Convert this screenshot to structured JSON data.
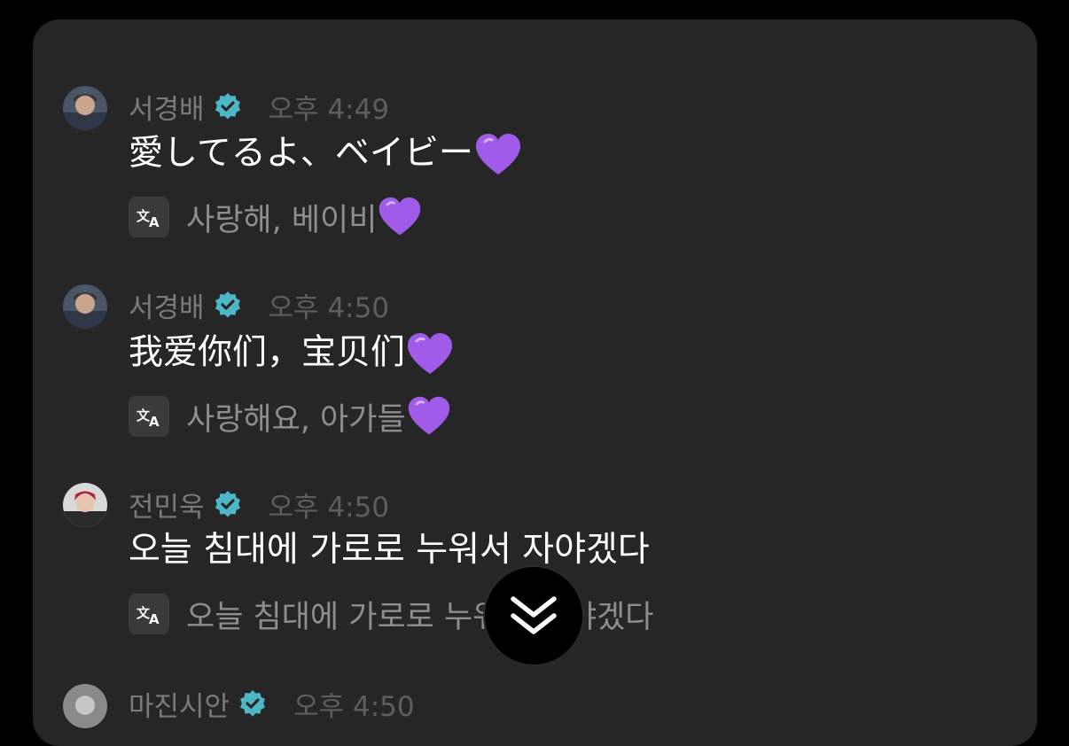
{
  "messages": [
    {
      "username": "서경배",
      "time": "오후 4:49",
      "text": "愛してるよ、ベイビー",
      "text_emoji": "purple-heart",
      "translation": "사랑해, 베이비",
      "translation_emoji": "purple-heart"
    },
    {
      "username": "서경배",
      "time": "오후 4:50",
      "text": "我爱你们，宝贝们",
      "text_emoji": "purple-heart",
      "translation": "사랑해요, 아가들",
      "translation_emoji": "purple-heart"
    },
    {
      "username": "전민욱",
      "time": "오후 4:50",
      "text": "오늘 침대에 가로로 누워서 자야겠다",
      "translation": "오늘 침대에 가로로 누워서 자야겠다"
    },
    {
      "username": "마진시안",
      "time": "오후 4:50"
    }
  ],
  "icons": {
    "verified": "verified-badge-icon",
    "translate": "translate-icon",
    "scroll_down": "double-chevron-down-icon"
  },
  "colors": {
    "background": "#000000",
    "panel": "#262626",
    "verified_badge": "#4fb6c8",
    "heart": "#a05ce8"
  }
}
